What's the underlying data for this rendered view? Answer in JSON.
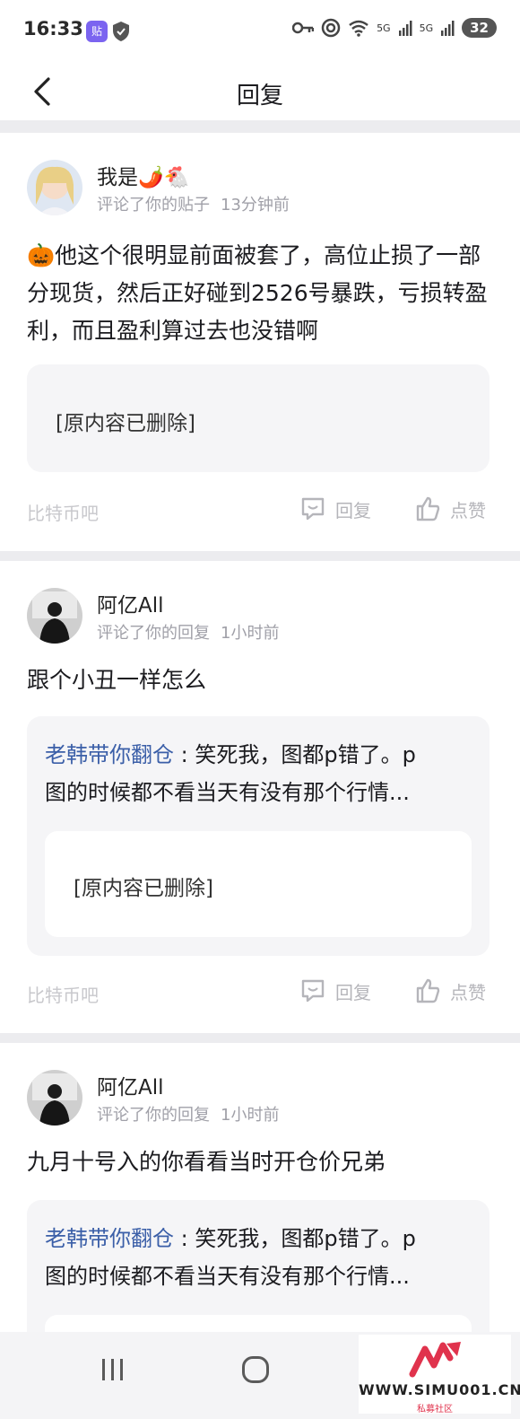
{
  "status_bar": {
    "time": "16:33",
    "app_badge": "贴",
    "battery": "32",
    "net1": "5G",
    "net2": "5G"
  },
  "header": {
    "title": "回复"
  },
  "items": [
    {
      "user": "我是🌶️🐔",
      "action": "评论了你的贴子",
      "time": "13分钟前",
      "text": "🎃他这个很明显前面被套了，高位止损了一部分现货，然后正好碰到2526号暴跌，亏损转盈利，而且盈利算过去也没错啊",
      "deleted_text": "[原内容已删除]",
      "forum": "比特币吧",
      "reply_label": "回复",
      "like_label": "点赞"
    },
    {
      "user": "阿亿All",
      "action": "评论了你的回复",
      "time": "1小时前",
      "text": "跟个小丑一样怎么",
      "quote_author": "老韩带你翻仓",
      "quote_line1": "笑死我，图都p错了。p",
      "quote_line2": "图的时候都不看当天有没有那个行情...",
      "deleted_text": "[原内容已删除]",
      "forum": "比特币吧",
      "reply_label": "回复",
      "like_label": "点赞"
    },
    {
      "user": "阿亿All",
      "action": "评论了你的回复",
      "time": "1小时前",
      "text": "九月十号入的你看看当时开仓价兄弟",
      "quote_author": "老韩带你翻仓",
      "quote_line1": "笑死我，图都p错了。p",
      "quote_line2": "图的时候都不看当天有没有那个行情..."
    }
  ],
  "quote_sep": " : ",
  "watermark": {
    "text": "WWW.SIMU001.CN",
    "sub": "私募社区"
  }
}
